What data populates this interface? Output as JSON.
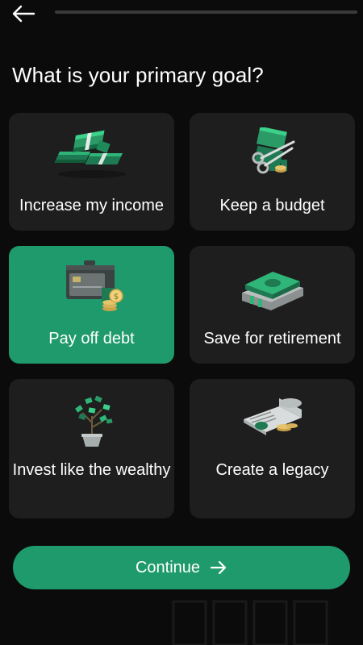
{
  "header": {
    "back_icon": "arrow-left-icon",
    "progress_fraction": 0.0
  },
  "title": "What is your primary goal?",
  "options": [
    {
      "label": "Increase my income",
      "icon": "money-stack-icon",
      "selected": false
    },
    {
      "label": "Keep a budget",
      "icon": "scissors-money-icon",
      "selected": false
    },
    {
      "label": "Pay off debt",
      "icon": "wallet-card-coins-icon",
      "selected": true
    },
    {
      "label": "Save for retirement",
      "icon": "book-money-icon",
      "selected": false
    },
    {
      "label": "Invest like the wealthy",
      "icon": "money-tree-icon",
      "selected": false
    },
    {
      "label": "Create a legacy",
      "icon": "document-scroll-coins-icon",
      "selected": false
    }
  ],
  "continue_button": {
    "label": "Continue",
    "icon": "arrow-right-icon"
  },
  "colors": {
    "background": "#0b0b0b",
    "card": "#1e1e1e",
    "accent": "#1f9a6d"
  }
}
